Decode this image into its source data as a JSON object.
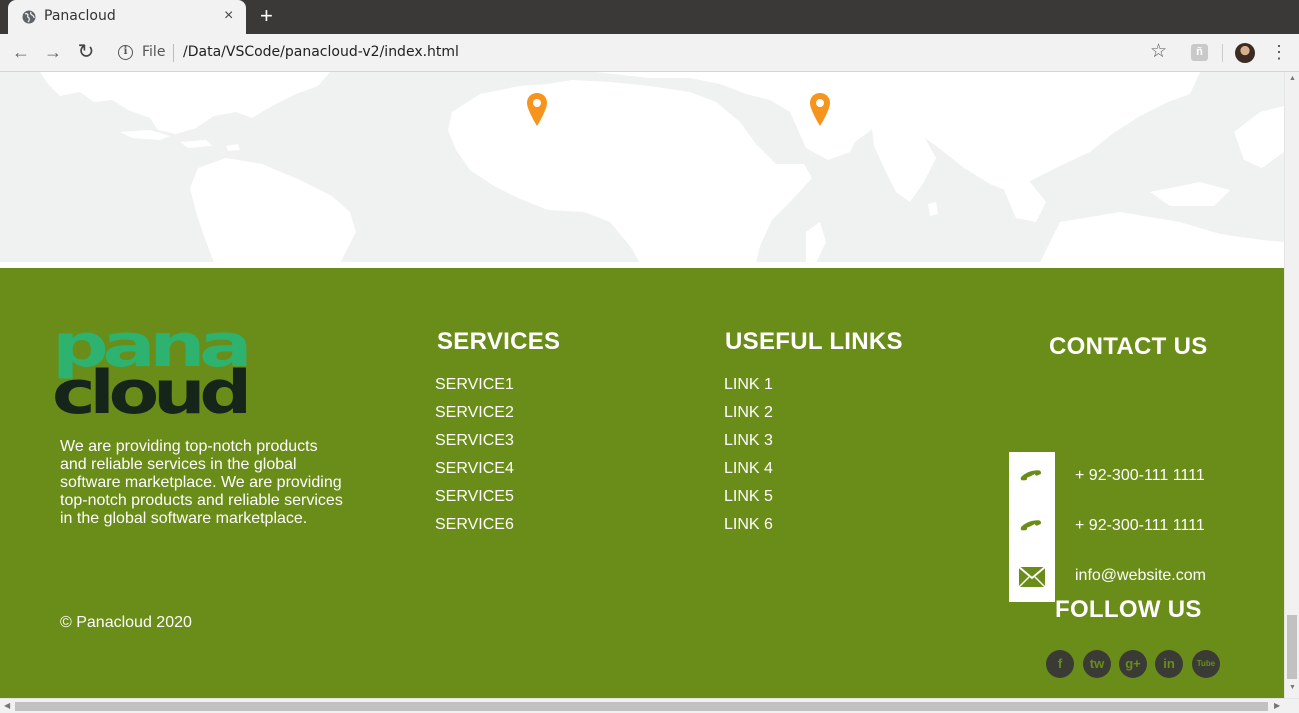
{
  "browser": {
    "tab_title": "Panacloud",
    "tab_close": "×",
    "new_tab": "+",
    "back": "←",
    "forward": "→",
    "reload": "↻",
    "info": "i",
    "file_label": "File",
    "url": "/Data/VSCode/panacloud-v2/index.html",
    "star": "☆",
    "extension": "ñ",
    "menu": "⋮"
  },
  "map": {
    "marker_color": "#f7941d",
    "land_color": "#ffffff",
    "ocean_color": "#f0f1f1"
  },
  "footer": {
    "background": "#6a8c19",
    "logo": {
      "line1": "pana",
      "line2": "cloud",
      "top_color": "#2db36f",
      "bottom_color": "#15251a"
    },
    "about": "We are providing top-notch products and reliable services in the global software marketplace. We are providing top-notch products and reliable services in the global software marketplace.",
    "copyright": "© Panacloud 2020",
    "services": {
      "title": "SERVICES",
      "items": [
        "SERVICE1",
        "SERVICE2",
        "SERVICE3",
        "SERVICE4",
        "SERVICE5",
        "SERVICE6"
      ]
    },
    "links": {
      "title": "USEFUL LINKS",
      "items": [
        "LINK 1",
        "LINK 2",
        "LINK 3",
        "LINK 4",
        "LINK 5",
        "LINK 6"
      ]
    },
    "contact": {
      "title": "CONTACT US",
      "phone1": "+ 92-300-111 1111",
      "phone2": "+ 92-300-111 1111",
      "email": "info@website.com"
    },
    "follow": {
      "title": "FOLLOW US",
      "networks": [
        "f",
        "tw",
        "g+",
        "in",
        "Tube"
      ]
    }
  },
  "scrollbars": {
    "up": "▲",
    "down": "▼",
    "left": "◀",
    "right": "▶"
  }
}
